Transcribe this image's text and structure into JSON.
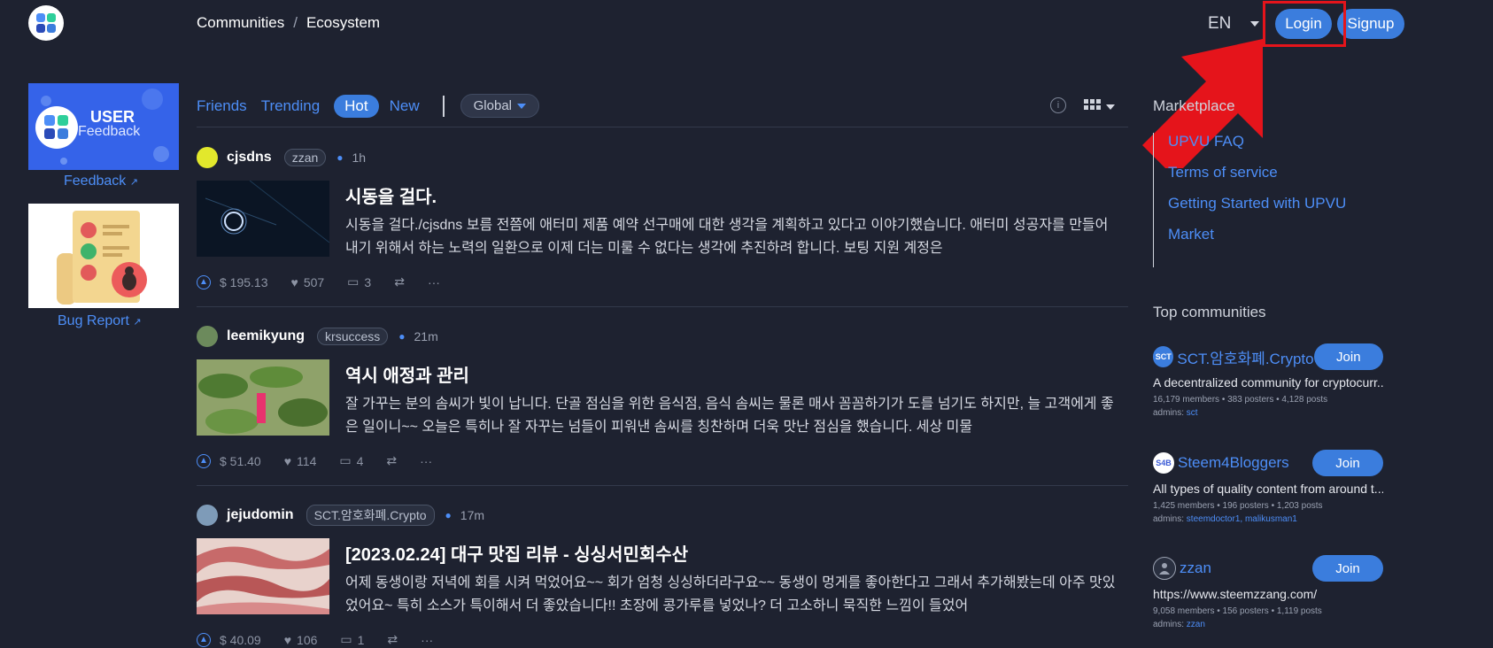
{
  "header": {
    "breadcrumb": [
      "Communities",
      "Ecosystem"
    ],
    "breadcrumb_sep": "/",
    "lang": "EN",
    "login_label": "Login",
    "signup_label": "Signup"
  },
  "left": {
    "feedback_card": {
      "line1": "USER",
      "line2": "Feedback"
    },
    "feedback_link": "Feedback",
    "bug_link": "Bug Report"
  },
  "tabs": {
    "items": [
      "Friends",
      "Trending",
      "Hot",
      "New"
    ],
    "active": "Hot",
    "filter": "Global",
    "info_icon": "i"
  },
  "posts": [
    {
      "author": "cjsdns",
      "community": "zzan",
      "time": "1h",
      "title": "시동을 걸다.",
      "excerpt": "시동을 걸다./cjsdns 보름 전쯤에 애터미 제품 예약 선구매에 대한 생각을 계획하고 있다고 이야기했습니다. 애터미 성공자를 만들어 내기 위해서 하는 노력의 일환으로 이제 더는 미룰 수 없다는 생각에 추진하려 합니다. 보팅 지원 계정은",
      "payout": "$ 195.13",
      "votes": "507",
      "comments": "3"
    },
    {
      "author": "leemikyung",
      "community": "krsuccess",
      "time": "21m",
      "title": "역시 애정과 관리",
      "excerpt": "잘 가꾸는 분의 솜씨가 빛이 납니다. 단골 점심을 위한 음식점, 음식 솜씨는 물론 매사 꼼꼼하기가 도를 넘기도 하지만, 늘 고객에게 좋은 일이니~~ 오늘은 특히나 잘 자꾸는 넘들이 피워낸 솜씨를 칭찬하며 더욱 맛난 점심을 했습니다. 세상 미물",
      "payout": "$ 51.40",
      "votes": "114",
      "comments": "4"
    },
    {
      "author": "jejudomin",
      "community": "SCT.암호화폐.Crypto",
      "time": "17m",
      "title": "[2023.02.24] 대구 맛집 리뷰 - 싱싱서민회수산",
      "excerpt": "어제 동생이랑 저녁에 회를 시켜 먹었어요~~ 회가 엄청 싱싱하더라구요~~ 동생이 멍게를 좋아한다고 그래서 추가해봤는데 아주 맛있었어요~ 특히 소스가 특이해서 더 좋았습니다!! 초장에 콩가루를 넣었나? 더 고소하니 묵직한 느낌이 들었어",
      "payout": "$ 40.09",
      "votes": "106",
      "comments": "1"
    }
  ],
  "right": {
    "marketplace_title": "Marketplace",
    "marketplace_links": [
      "UPVU FAQ",
      "Terms of service",
      "Getting Started with UPVU",
      "Market"
    ],
    "top_communities_title": "Top communities",
    "communities": [
      {
        "icon_text": "SCT",
        "name": "SCT.암호화폐.Crypto",
        "join": "Join",
        "desc": "A decentralized community for cryptocurr...",
        "stats": "16,179 members •   383 posters •   4,128 posts",
        "admins_label": "admins:",
        "admins": "sct"
      },
      {
        "icon_text": "S4B",
        "name": "Steem4Bloggers",
        "join": "Join",
        "desc": "All types of quality content from around t...",
        "stats": "1,425 members •   196 posters •   1,203 posts",
        "admins_label": "admins:",
        "admins": "steemdoctor1,  malikusman1"
      },
      {
        "icon_text": "",
        "name": "zzan",
        "join": "Join",
        "desc": "https://www.steemzzang.com/",
        "stats": "9,058 members •   156 posters •   1,119 posts",
        "admins_label": "admins:",
        "admins": "zzan"
      }
    ]
  },
  "colors": {
    "background": "#1e2230",
    "accent": "#3b7ddd",
    "link": "#4d8ef7",
    "highlight_red": "#e5141b"
  }
}
